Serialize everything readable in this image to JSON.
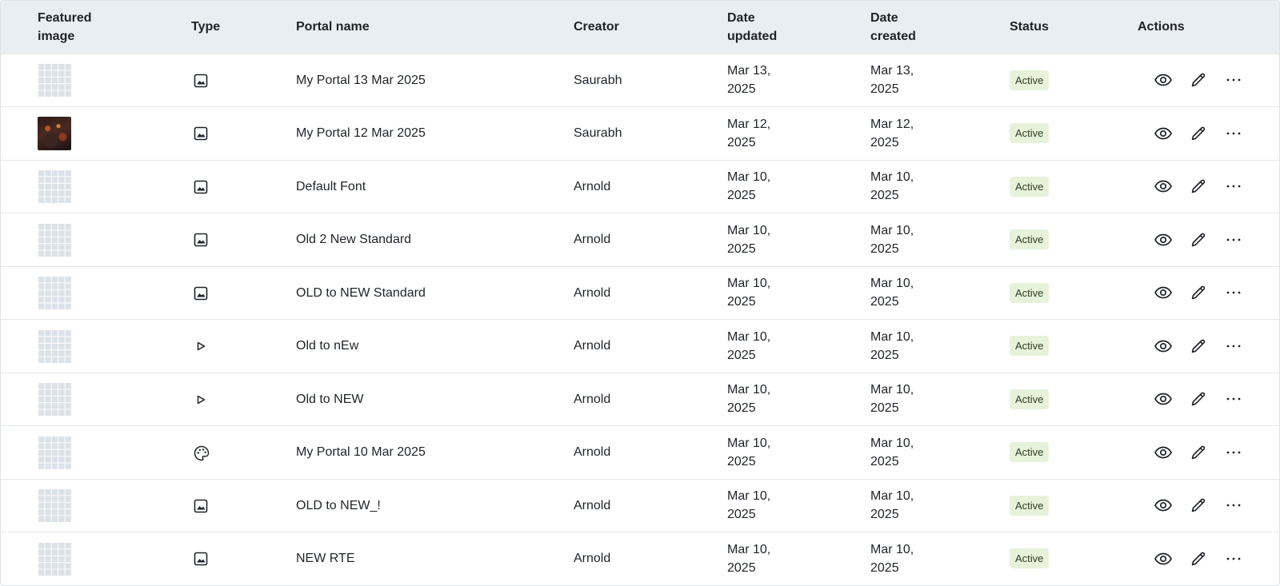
{
  "table": {
    "headers": {
      "featured_image": "Featured image",
      "type": "Type",
      "portal_name": "Portal name",
      "creator": "Creator",
      "date_updated": "Date updated",
      "date_created": "Date created",
      "status": "Status",
      "actions": "Actions"
    },
    "rows": [
      {
        "thumb": "placeholder",
        "type_icon": "image-icon",
        "name": "My Portal 13 Mar 2025",
        "creator": "Saurabh",
        "updated_line1": "Mar 13,",
        "updated_line2": "2025",
        "created_line1": "Mar 13,",
        "created_line2": "2025",
        "status": "Active"
      },
      {
        "thumb": "photo",
        "type_icon": "image-icon",
        "name": "My Portal 12 Mar 2025",
        "creator": "Saurabh",
        "updated_line1": "Mar 12,",
        "updated_line2": "2025",
        "created_line1": "Mar 12,",
        "created_line2": "2025",
        "status": "Active"
      },
      {
        "thumb": "placeholder",
        "type_icon": "image-icon",
        "name": "Default Font",
        "creator": "Arnold",
        "updated_line1": "Mar 10,",
        "updated_line2": "2025",
        "created_line1": "Mar 10,",
        "created_line2": "2025",
        "status": "Active"
      },
      {
        "thumb": "placeholder",
        "type_icon": "image-icon",
        "name": "Old 2 New Standard",
        "creator": "Arnold",
        "updated_line1": "Mar 10,",
        "updated_line2": "2025",
        "created_line1": "Mar 10,",
        "created_line2": "2025",
        "status": "Active"
      },
      {
        "thumb": "placeholder",
        "type_icon": "image-icon",
        "name": "OLD to NEW Standard",
        "creator": "Arnold",
        "updated_line1": "Mar 10,",
        "updated_line2": "2025",
        "created_line1": "Mar 10,",
        "created_line2": "2025",
        "status": "Active"
      },
      {
        "thumb": "placeholder",
        "type_icon": "play-icon",
        "name": "Old to nEw",
        "creator": "Arnold",
        "updated_line1": "Mar 10,",
        "updated_line2": "2025",
        "created_line1": "Mar 10,",
        "created_line2": "2025",
        "status": "Active"
      },
      {
        "thumb": "placeholder",
        "type_icon": "play-icon",
        "name": "Old to NEW",
        "creator": "Arnold",
        "updated_line1": "Mar 10,",
        "updated_line2": "2025",
        "created_line1": "Mar 10,",
        "created_line2": "2025",
        "status": "Active"
      },
      {
        "thumb": "placeholder",
        "type_icon": "palette-icon",
        "name": "My Portal 10 Mar 2025",
        "creator": "Arnold",
        "updated_line1": "Mar 10,",
        "updated_line2": "2025",
        "created_line1": "Mar 10,",
        "created_line2": "2025",
        "status": "Active"
      },
      {
        "thumb": "placeholder",
        "type_icon": "image-icon",
        "name": "OLD to NEW_!",
        "creator": "Arnold",
        "updated_line1": "Mar 10,",
        "updated_line2": "2025",
        "created_line1": "Mar 10,",
        "created_line2": "2025",
        "status": "Active"
      },
      {
        "thumb": "placeholder",
        "type_icon": "image-icon",
        "name": "NEW RTE",
        "creator": "Arnold",
        "updated_line1": "Mar 10,",
        "updated_line2": "2025",
        "created_line1": "Mar 10,",
        "created_line2": "2025",
        "status": "Active"
      }
    ],
    "row_actions": [
      "eye-icon",
      "pencil-icon",
      "more-horizontal-icon"
    ]
  },
  "colors": {
    "header_bg": "#e9eef2",
    "border": "#e4e7eb",
    "badge_bg": "#e6f2da",
    "text": "#1f2328"
  }
}
